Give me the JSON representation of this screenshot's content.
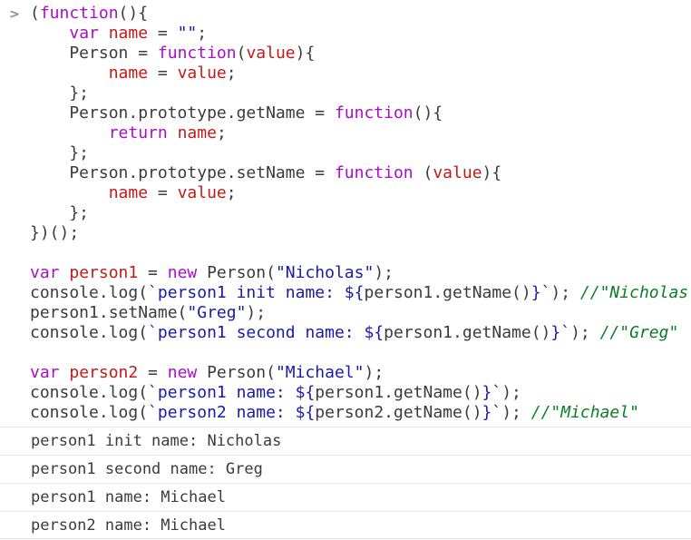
{
  "console": {
    "prompt_symbol": ">",
    "input": {
      "lines": [
        [
          {
            "t": "plain",
            "s": "("
          },
          {
            "t": "kw",
            "s": "function"
          },
          {
            "t": "plain",
            "s": "(){"
          }
        ],
        [
          {
            "t": "plain",
            "s": "    "
          },
          {
            "t": "kw",
            "s": "var"
          },
          {
            "t": "plain",
            "s": " "
          },
          {
            "t": "var",
            "s": "name"
          },
          {
            "t": "plain",
            "s": " = "
          },
          {
            "t": "str",
            "s": "\"\""
          },
          {
            "t": "plain",
            "s": ";"
          }
        ],
        [
          {
            "t": "plain",
            "s": "    Person = "
          },
          {
            "t": "kw",
            "s": "function"
          },
          {
            "t": "plain",
            "s": "("
          },
          {
            "t": "var",
            "s": "value"
          },
          {
            "t": "plain",
            "s": "){"
          }
        ],
        [
          {
            "t": "plain",
            "s": "        "
          },
          {
            "t": "var",
            "s": "name"
          },
          {
            "t": "plain",
            "s": " = "
          },
          {
            "t": "var",
            "s": "value"
          },
          {
            "t": "plain",
            "s": ";"
          }
        ],
        [
          {
            "t": "plain",
            "s": "    };"
          }
        ],
        [
          {
            "t": "plain",
            "s": "    Person.prototype.getName = "
          },
          {
            "t": "kw",
            "s": "function"
          },
          {
            "t": "plain",
            "s": "(){"
          }
        ],
        [
          {
            "t": "plain",
            "s": "        "
          },
          {
            "t": "kw",
            "s": "return"
          },
          {
            "t": "plain",
            "s": " "
          },
          {
            "t": "var",
            "s": "name"
          },
          {
            "t": "plain",
            "s": ";"
          }
        ],
        [
          {
            "t": "plain",
            "s": "    };"
          }
        ],
        [
          {
            "t": "plain",
            "s": "    Person.prototype.setName = "
          },
          {
            "t": "kw",
            "s": "function"
          },
          {
            "t": "plain",
            "s": " ("
          },
          {
            "t": "var",
            "s": "value"
          },
          {
            "t": "plain",
            "s": "){"
          }
        ],
        [
          {
            "t": "plain",
            "s": "        "
          },
          {
            "t": "var",
            "s": "name"
          },
          {
            "t": "plain",
            "s": " = "
          },
          {
            "t": "var",
            "s": "value"
          },
          {
            "t": "plain",
            "s": ";"
          }
        ],
        [
          {
            "t": "plain",
            "s": "    };"
          }
        ],
        [
          {
            "t": "plain",
            "s": "})();"
          }
        ],
        [],
        [
          {
            "t": "kw",
            "s": "var"
          },
          {
            "t": "plain",
            "s": " "
          },
          {
            "t": "var",
            "s": "person1"
          },
          {
            "t": "plain",
            "s": " = "
          },
          {
            "t": "kw",
            "s": "new"
          },
          {
            "t": "plain",
            "s": " Person("
          },
          {
            "t": "str",
            "s": "\"Nicholas\""
          },
          {
            "t": "plain",
            "s": ");"
          }
        ],
        [
          {
            "t": "plain",
            "s": "console.log("
          },
          {
            "t": "str",
            "s": "`person1 init name: "
          },
          {
            "t": "delim",
            "s": "${"
          },
          {
            "t": "interp",
            "s": "person1.getName()"
          },
          {
            "t": "delim",
            "s": "}"
          },
          {
            "t": "str",
            "s": "`"
          },
          {
            "t": "plain",
            "s": "); "
          },
          {
            "t": "comment",
            "s": "//\"Nicholas\""
          }
        ],
        [
          {
            "t": "plain",
            "s": "person1.setName("
          },
          {
            "t": "str",
            "s": "\"Greg\""
          },
          {
            "t": "plain",
            "s": ");"
          }
        ],
        [
          {
            "t": "plain",
            "s": "console.log("
          },
          {
            "t": "str",
            "s": "`person1 second name: "
          },
          {
            "t": "delim",
            "s": "${"
          },
          {
            "t": "interp",
            "s": "person1.getName()"
          },
          {
            "t": "delim",
            "s": "}"
          },
          {
            "t": "str",
            "s": "`"
          },
          {
            "t": "plain",
            "s": "); "
          },
          {
            "t": "comment",
            "s": "//\"Greg\""
          }
        ],
        [],
        [
          {
            "t": "kw",
            "s": "var"
          },
          {
            "t": "plain",
            "s": " "
          },
          {
            "t": "var",
            "s": "person2"
          },
          {
            "t": "plain",
            "s": " = "
          },
          {
            "t": "kw",
            "s": "new"
          },
          {
            "t": "plain",
            "s": " Person("
          },
          {
            "t": "str",
            "s": "\"Michael\""
          },
          {
            "t": "plain",
            "s": ");"
          }
        ],
        [
          {
            "t": "plain",
            "s": "console.log("
          },
          {
            "t": "str",
            "s": "`person1 name: "
          },
          {
            "t": "delim",
            "s": "${"
          },
          {
            "t": "interp",
            "s": "person1.getName()"
          },
          {
            "t": "delim",
            "s": "}"
          },
          {
            "t": "str",
            "s": "`"
          },
          {
            "t": "plain",
            "s": ");"
          }
        ],
        [
          {
            "t": "plain",
            "s": "console.log("
          },
          {
            "t": "str",
            "s": "`person2 name: "
          },
          {
            "t": "delim",
            "s": "${"
          },
          {
            "t": "interp",
            "s": "person2.getName()"
          },
          {
            "t": "delim",
            "s": "}"
          },
          {
            "t": "str",
            "s": "`"
          },
          {
            "t": "plain",
            "s": "); "
          },
          {
            "t": "comment",
            "s": "//\"Michael\""
          }
        ]
      ]
    },
    "output": {
      "rows": [
        "person1 init name: Nicholas",
        "person1 second name: Greg",
        "person1 name: Michael",
        "person2 name: Michael"
      ]
    },
    "colors": {
      "keyword": "#aa0dca",
      "variable": "#c41a16",
      "string": "#1a1aa6",
      "comment": "#0b7d22",
      "plain": "#3b3b3b",
      "prompt": "#8c8c8c",
      "row_divider": "#e8e8e8",
      "background": "#ffffff"
    }
  }
}
